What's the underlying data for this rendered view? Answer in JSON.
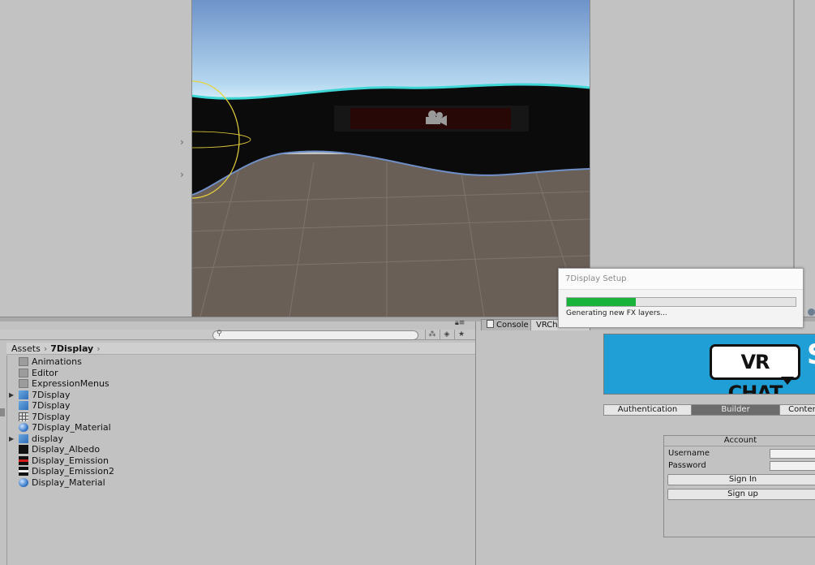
{
  "project": {
    "breadcrumb": [
      "Assets",
      "7Display"
    ],
    "search": {
      "placeholder": ""
    },
    "assets": [
      {
        "name": "Animations",
        "icon": "folder-icon",
        "foldable": false
      },
      {
        "name": "Editor",
        "icon": "folder-icon",
        "foldable": false
      },
      {
        "name": "ExpressionMenus",
        "icon": "folder-icon",
        "foldable": false
      },
      {
        "name": "7Display",
        "icon": "prefab-icon",
        "foldable": true
      },
      {
        "name": "7Display",
        "icon": "prefab-icon",
        "foldable": false
      },
      {
        "name": "7Display",
        "icon": "grid-asset-icon",
        "foldable": false
      },
      {
        "name": "7Display_Material",
        "icon": "material-icon",
        "foldable": false
      },
      {
        "name": "display",
        "icon": "model-prefab-icon",
        "foldable": true
      },
      {
        "name": "Display_Albedo",
        "icon": "texture-black-icon",
        "foldable": false
      },
      {
        "name": "Display_Emission",
        "icon": "texture-red-icon",
        "foldable": false
      },
      {
        "name": "Display_Emission2",
        "icon": "texture-white-icon",
        "foldable": false
      },
      {
        "name": "Display_Material",
        "icon": "material-icon",
        "foldable": false
      }
    ]
  },
  "tabs": {
    "console": "Console",
    "vrchat_sdk": "VRChat SDK"
  },
  "sdk": {
    "logo_text": "VR CHAT",
    "banner_suffix": "S",
    "mode_tabs": [
      "Authentication",
      "Builder",
      "Content"
    ],
    "active_mode": 1,
    "account": {
      "header": "Account",
      "username_label": "Username",
      "password_label": "Password",
      "sign_in": "Sign In",
      "sign_up": "Sign up"
    }
  },
  "dialog": {
    "title": "7Display Setup",
    "info": "Generating new FX layers...",
    "progress": 0.3
  },
  "colors": {
    "progress": "#17b33a",
    "banner": "#1f9fd6",
    "selected_tab": "#6c6c6c"
  }
}
